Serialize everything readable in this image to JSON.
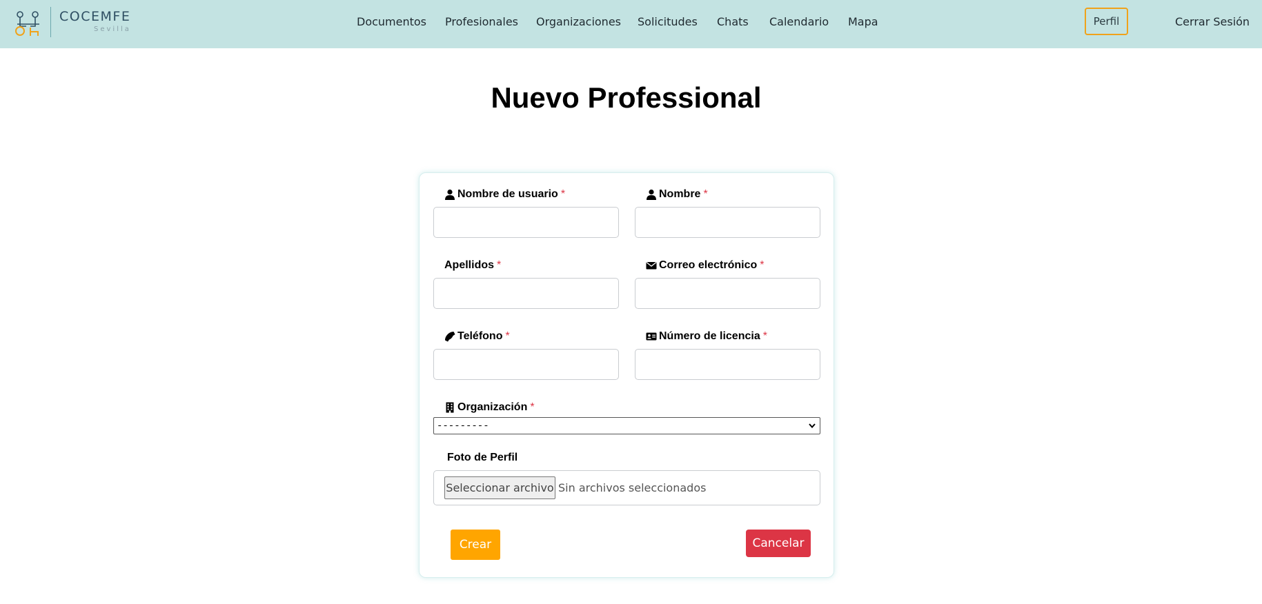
{
  "navbar": {
    "logo_title": "COCEMFE",
    "logo_subtitle": "Sevilla",
    "links": [
      "Documentos",
      "Profesionales",
      "Organizaciones",
      "Solicitudes",
      "Chats",
      "Calendario",
      "Mapa"
    ],
    "profile_label": "Perfil",
    "logout_label": "Cerrar Sesión",
    "background_color": "#c3e3e2",
    "profile_border_color": "#f0a21a"
  },
  "page": {
    "title": "Nuevo Professional"
  },
  "form": {
    "required_marker": "*",
    "fields": {
      "username": {
        "label": "Nombre de usuario",
        "icon": "user-icon",
        "value": ""
      },
      "first_name": {
        "label": "Nombre",
        "icon": "user-icon",
        "value": ""
      },
      "last_name": {
        "label": "Apellidos",
        "value": ""
      },
      "email": {
        "label": "Correo electrónico",
        "icon": "envelope-icon",
        "value": ""
      },
      "phone": {
        "label": "Teléfono",
        "icon": "phone-icon",
        "value": ""
      },
      "license": {
        "label": "Número de licencia",
        "icon": "id-card-icon",
        "value": ""
      }
    },
    "organization": {
      "label": "Organización",
      "icon": "building-icon",
      "selected": "---------"
    },
    "photo": {
      "label": "Foto de Perfil",
      "button_label": "Seleccionar archivo",
      "status": "Sin archivos seleccionados"
    },
    "create_label": "Crear",
    "cancel_label": "Cancelar",
    "create_color": "#ffa500",
    "cancel_color": "#dc3545",
    "required_color": "#dc3545"
  }
}
